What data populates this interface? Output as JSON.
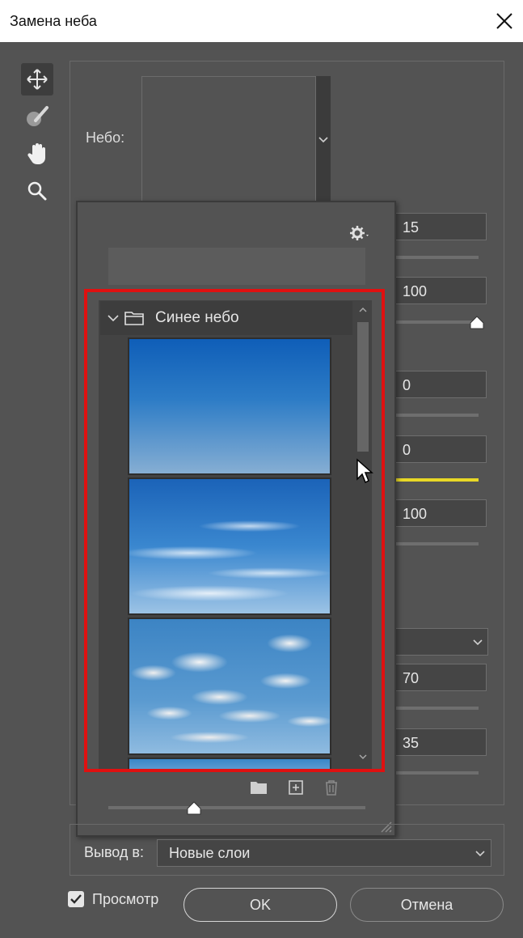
{
  "window": {
    "title": "Замена неба"
  },
  "sky_section": {
    "label": "Небо:"
  },
  "values": [
    "15",
    "100",
    "0",
    "0",
    "100",
    "70",
    "35"
  ],
  "sky_browser": {
    "folder_name": "Синее небо",
    "thumbnails": [
      "sky-thumbnail-1",
      "sky-thumbnail-2",
      "sky-thumbnail-3",
      "sky-thumbnail-4"
    ]
  },
  "output": {
    "label": "Вывод в:",
    "selected": "Новые слои"
  },
  "preview": {
    "label": "Просмотр",
    "checked": true
  },
  "buttons": {
    "ok": "OK",
    "cancel": "Отмена"
  },
  "colors": {
    "highlight": "#e01010",
    "slider_accent": "#e8d826"
  }
}
